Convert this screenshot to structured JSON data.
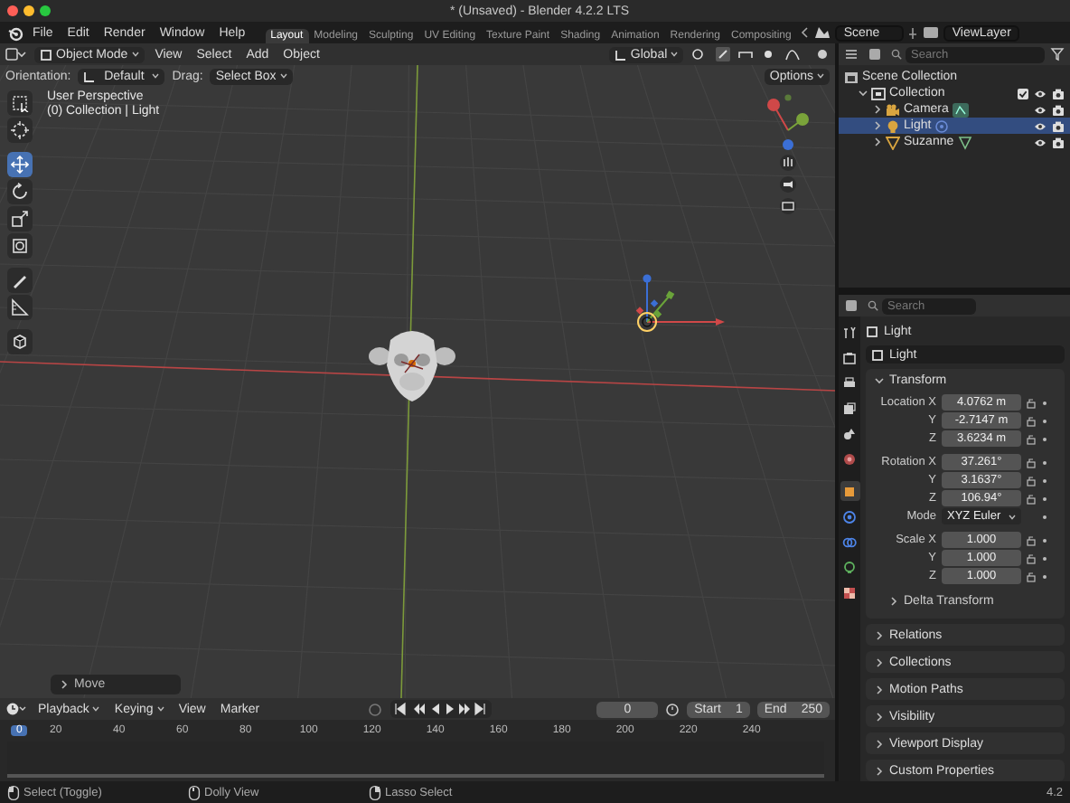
{
  "window": {
    "title": "* (Unsaved) - Blender 4.2.2 LTS"
  },
  "menu": [
    "File",
    "Edit",
    "Render",
    "Window",
    "Help"
  ],
  "workspaces": [
    {
      "label": "Layout",
      "selected": true
    },
    {
      "label": "Modeling",
      "selected": false
    },
    {
      "label": "Sculpting",
      "selected": false
    },
    {
      "label": "UV Editing",
      "selected": false
    },
    {
      "label": "Texture Paint",
      "selected": false
    },
    {
      "label": "Shading",
      "selected": false
    },
    {
      "label": "Animation",
      "selected": false
    },
    {
      "label": "Rendering",
      "selected": false
    },
    {
      "label": "Compositing",
      "selected": false
    }
  ],
  "scene": "Scene",
  "view_layer": "ViewLayer",
  "viewport": {
    "mode": "Object Mode",
    "menus": [
      "View",
      "Select",
      "Add",
      "Object"
    ],
    "orientation": "Global",
    "tool_settings": {
      "orientation_label": "Orientation:",
      "orientation": "Default",
      "drag_label": "Drag:",
      "drag": "Select Box",
      "options": "Options"
    },
    "tools": [
      {
        "kind": "select",
        "selected": false
      },
      {
        "kind": "cursor",
        "selected": false
      },
      {
        "kind": "move",
        "selected": true
      },
      {
        "kind": "rotate",
        "selected": false
      },
      {
        "kind": "scale",
        "selected": false
      },
      {
        "kind": "transform",
        "selected": false
      },
      {
        "kind": "annotate",
        "selected": false
      },
      {
        "kind": "measure",
        "selected": false
      },
      {
        "kind": "add-cube",
        "selected": false
      }
    ],
    "overlay_text": [
      "User Perspective",
      "(0) Collection | Light"
    ],
    "last_operator": "Move"
  },
  "outliner": {
    "search": {
      "placeholder": "Search"
    },
    "tree": [
      {
        "label": "Scene Collection",
        "kind": "scene",
        "children": [
          {
            "label": "Collection",
            "kind": "collection",
            "expanded": true,
            "checked": true,
            "children": [
              {
                "label": "Camera",
                "kind": "camera",
                "expanded": false,
                "selected": false
              },
              {
                "label": "Light",
                "kind": "light",
                "expanded": false,
                "selected": true
              },
              {
                "label": "Suzanne",
                "kind": "mesh",
                "expanded": false,
                "selected": false
              }
            ]
          }
        ]
      }
    ]
  },
  "properties": {
    "search": {
      "placeholder": "Search"
    },
    "tabs": [
      {
        "kind": "tool",
        "selected": false
      },
      {
        "kind": "render",
        "selected": false
      },
      {
        "kind": "output",
        "selected": false
      },
      {
        "kind": "view-layer",
        "selected": false
      },
      {
        "kind": "scene",
        "selected": false
      },
      {
        "kind": "world",
        "selected": false
      },
      {
        "kind": "object",
        "selected": true
      },
      {
        "kind": "physics",
        "selected": false
      },
      {
        "kind": "constraints",
        "selected": false
      },
      {
        "kind": "light-data",
        "selected": false
      },
      {
        "kind": "texture",
        "selected": false
      }
    ],
    "context": "Light",
    "object_name": "Light",
    "transform": {
      "title": "Transform",
      "expanded": true,
      "groups": [
        [
          {
            "kind": "number",
            "label": "Location X",
            "value": "4.0762 m"
          },
          {
            "kind": "number",
            "label": "Y",
            "value": "-2.7147 m"
          },
          {
            "kind": "number",
            "label": "Z",
            "value": "3.6234 m"
          }
        ],
        [
          {
            "kind": "number",
            "label": "Rotation X",
            "value": "37.261°"
          },
          {
            "kind": "number",
            "label": "Y",
            "value": "3.1637°"
          },
          {
            "kind": "number",
            "label": "Z",
            "value": "106.94°"
          },
          {
            "kind": "dropdown",
            "label": "Mode",
            "value": "XYZ Euler"
          }
        ],
        [
          {
            "kind": "number",
            "label": "Scale X",
            "value": "1.000"
          },
          {
            "kind": "number",
            "label": "Y",
            "value": "1.000"
          },
          {
            "kind": "number",
            "label": "Z",
            "value": "1.000"
          }
        ]
      ],
      "subpanel": {
        "title": "Delta Transform",
        "expanded": false
      }
    },
    "panels": [
      {
        "title": "Relations",
        "expanded": false
      },
      {
        "title": "Collections",
        "expanded": false
      },
      {
        "title": "Motion Paths",
        "expanded": false
      },
      {
        "title": "Visibility",
        "expanded": false
      },
      {
        "title": "Viewport Display",
        "expanded": false
      },
      {
        "title": "Custom Properties",
        "expanded": false
      }
    ]
  },
  "timeline": {
    "menus": [
      "Playback",
      "Keying",
      "View",
      "Marker"
    ],
    "current_frame": "0",
    "start_label": "Start",
    "start": "1",
    "end_label": "End",
    "end": "250",
    "playhead": "0",
    "ticks": [
      "20",
      "40",
      "60",
      "80",
      "100",
      "120",
      "140",
      "160",
      "180",
      "200",
      "220",
      "240"
    ]
  },
  "status_bar": {
    "hints": [
      {
        "kind": "mouse-left",
        "label": "Select (Toggle)"
      },
      {
        "kind": "mouse-middle",
        "label": "Dolly View"
      },
      {
        "kind": "mouse-right",
        "label": "Lasso Select"
      }
    ],
    "version": "4.2"
  }
}
